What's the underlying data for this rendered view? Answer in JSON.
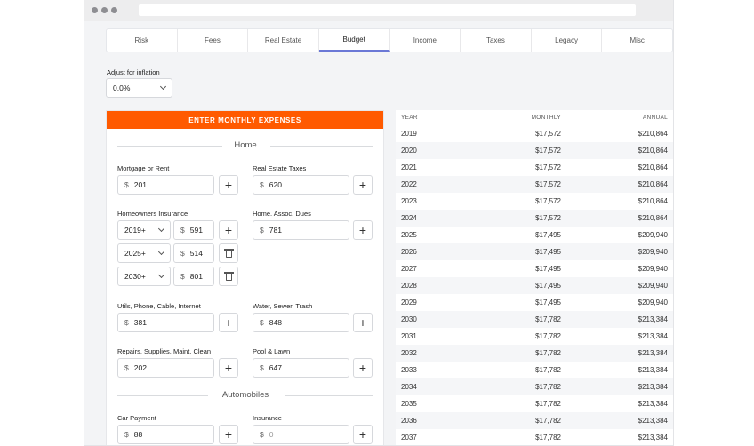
{
  "tabs": [
    "Risk",
    "Fees",
    "Real Estate",
    "Budget",
    "Income",
    "Taxes",
    "Legacy",
    "Misc"
  ],
  "active_tab": "Budget",
  "inflation": {
    "label": "Adjust for inflation",
    "value": "0.0%"
  },
  "panel": {
    "header": "ENTER MONTHLY EXPENSES",
    "sections": {
      "home": "Home",
      "automobiles": "Automobiles"
    },
    "currency": "$",
    "fields": {
      "mortgage": {
        "label": "Mortgage or Rent",
        "value": "201"
      },
      "re_taxes": {
        "label": "Real Estate Taxes",
        "value": "620"
      },
      "homeowners": {
        "label": "Homeowners Insurance",
        "rows": [
          {
            "year": "2019+",
            "value": "591"
          },
          {
            "year": "2025+",
            "value": "514"
          },
          {
            "year": "2030+",
            "value": "801"
          }
        ]
      },
      "hoa": {
        "label": "Home. Assoc. Dues",
        "value": "781"
      },
      "utils": {
        "label": "Utils, Phone, Cable, Internet",
        "value": "381"
      },
      "water": {
        "label": "Water, Sewer, Trash",
        "value": "848"
      },
      "repairs": {
        "label": "Repairs, Supplies, Maint, Clean",
        "value": "202"
      },
      "pool": {
        "label": "Pool & Lawn",
        "value": "647"
      },
      "car": {
        "label": "Car Payment",
        "value": "88"
      },
      "insurance": {
        "label": "Insurance",
        "placeholder": "0"
      }
    },
    "plus": "+"
  },
  "table": {
    "headers": {
      "year": "YEAR",
      "monthly": "MONTHLY",
      "annual": "ANNUAL"
    },
    "rows": [
      {
        "year": "2019",
        "monthly": "$17,572",
        "annual": "$210,864"
      },
      {
        "year": "2020",
        "monthly": "$17,572",
        "annual": "$210,864"
      },
      {
        "year": "2021",
        "monthly": "$17,572",
        "annual": "$210,864"
      },
      {
        "year": "2022",
        "monthly": "$17,572",
        "annual": "$210,864"
      },
      {
        "year": "2023",
        "monthly": "$17,572",
        "annual": "$210,864"
      },
      {
        "year": "2024",
        "monthly": "$17,572",
        "annual": "$210,864"
      },
      {
        "year": "2025",
        "monthly": "$17,495",
        "annual": "$209,940"
      },
      {
        "year": "2026",
        "monthly": "$17,495",
        "annual": "$209,940"
      },
      {
        "year": "2027",
        "monthly": "$17,495",
        "annual": "$209,940"
      },
      {
        "year": "2028",
        "monthly": "$17,495",
        "annual": "$209,940"
      },
      {
        "year": "2029",
        "monthly": "$17,495",
        "annual": "$209,940"
      },
      {
        "year": "2030",
        "monthly": "$17,782",
        "annual": "$213,384"
      },
      {
        "year": "2031",
        "monthly": "$17,782",
        "annual": "$213,384"
      },
      {
        "year": "2032",
        "monthly": "$17,782",
        "annual": "$213,384"
      },
      {
        "year": "2033",
        "monthly": "$17,782",
        "annual": "$213,384"
      },
      {
        "year": "2034",
        "monthly": "$17,782",
        "annual": "$213,384"
      },
      {
        "year": "2035",
        "monthly": "$17,782",
        "annual": "$213,384"
      },
      {
        "year": "2036",
        "monthly": "$17,782",
        "annual": "$213,384"
      },
      {
        "year": "2037",
        "monthly": "$17,782",
        "annual": "$213,384"
      }
    ]
  },
  "colors": {
    "accent": "#ff5a00",
    "tab_active_underline": "#6b78d6"
  }
}
